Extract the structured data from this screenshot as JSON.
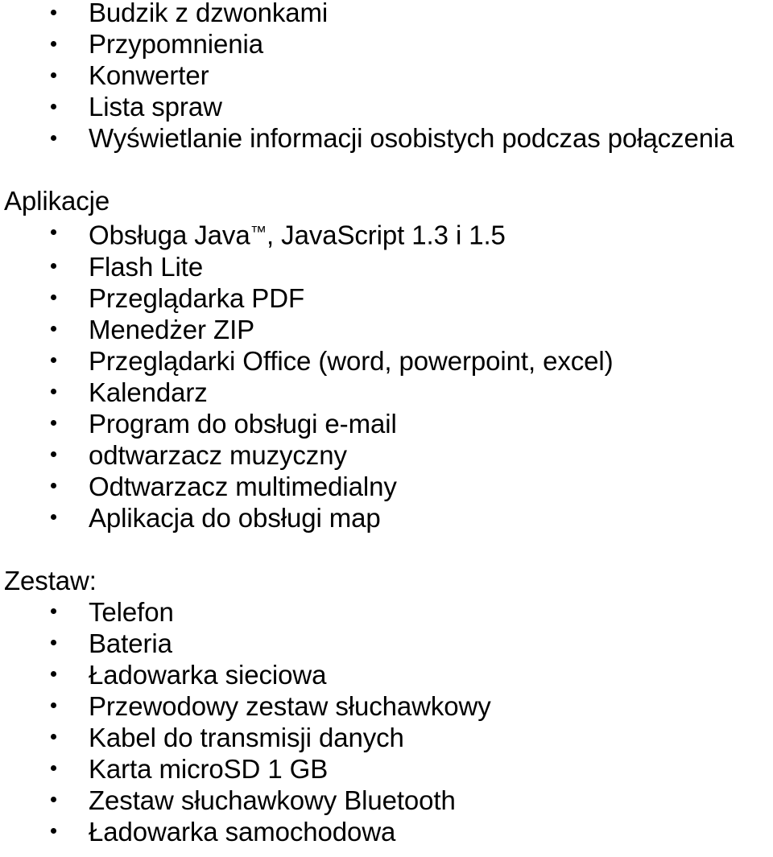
{
  "document": {
    "language": "pl",
    "text_color": "#000000",
    "background_color": "#ffffff",
    "bullet_glyph": "•"
  },
  "sections": [
    {
      "id": "features",
      "heading": null,
      "items": [
        {
          "text": "Budzik z dzwonkami"
        },
        {
          "text": "Przypomnienia"
        },
        {
          "text": "Konwerter"
        },
        {
          "text": "Lista spraw"
        },
        {
          "text": "Wyświetlanie informacji osobistych podczas połączenia"
        }
      ]
    },
    {
      "id": "aplikacje",
      "heading": "Aplikacje",
      "items": [
        {
          "text": "Obsługa Java",
          "trademark": "™",
          "text_after": ", JavaScript 1.3 i 1.5"
        },
        {
          "text": "Flash Lite"
        },
        {
          "text": "Przeglądarka PDF"
        },
        {
          "text": "Menedżer ZIP"
        },
        {
          "text": "Przeglądarki Office (word, powerpoint, excel)"
        },
        {
          "text": "Kalendarz"
        },
        {
          "text": "Program do obsługi e-mail"
        },
        {
          "text": "odtwarzacz muzyczny"
        },
        {
          "text": "Odtwarzacz multimedialny"
        },
        {
          "text": "Aplikacja do obsługi map"
        }
      ]
    },
    {
      "id": "zestaw",
      "heading": "Zestaw:",
      "items": [
        {
          "text": "Telefon"
        },
        {
          "text": "Bateria"
        },
        {
          "text": "Ładowarka sieciowa"
        },
        {
          "text": "Przewodowy zestaw słuchawkowy"
        },
        {
          "text": "Kabel do transmisji danych"
        },
        {
          "text": "Karta microSD 1 GB"
        },
        {
          "text": "Zestaw słuchawkowy Bluetooth"
        },
        {
          "text": "Ładowarka samochodowa"
        }
      ]
    }
  ]
}
